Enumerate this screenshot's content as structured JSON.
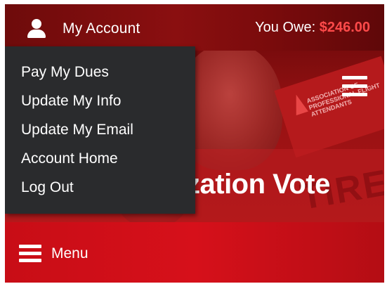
{
  "header": {
    "account_label": "My Account",
    "owe_label": "You Owe:",
    "owe_amount": "$246.00",
    "owe_color": "#ff4a4a"
  },
  "account_menu": {
    "items": [
      {
        "label": "Pay My Dues"
      },
      {
        "label": "Update My Info"
      },
      {
        "label": "Update My Email"
      },
      {
        "label": "Account Home"
      },
      {
        "label": "Log Out"
      }
    ]
  },
  "hero": {
    "title_fragment": "zation Vote",
    "sign_text": "ASSOCIATION OF PROFESSIONAL FLIGHT ATTENDANTS",
    "background_text": "TIRED"
  },
  "bottom_bar": {
    "menu_label": "Menu",
    "menu_icon": "hamburger-icon"
  },
  "colors": {
    "topbar": "#7a0b0c",
    "menubar": "#d6101a",
    "dropdown_bg": "#2a2b2d"
  }
}
